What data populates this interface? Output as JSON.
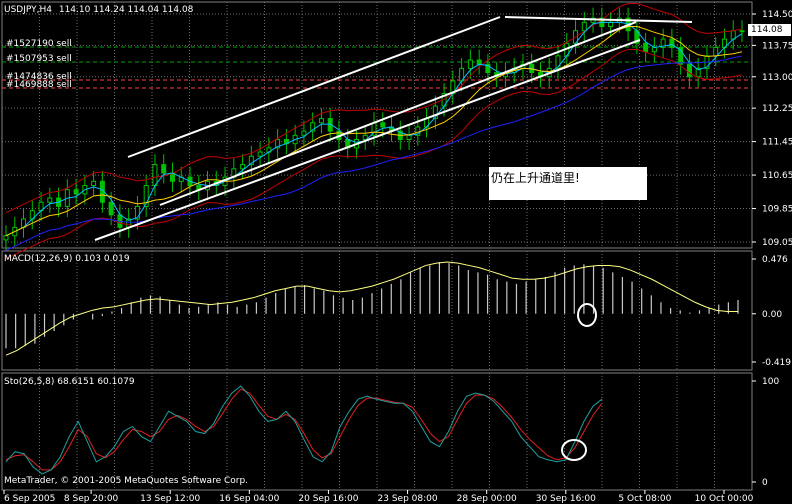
{
  "header": {
    "symbol": "USDJPY,H4",
    "ohlc": "114.10 114.24 114.04 114.08"
  },
  "price_label": "114.08",
  "annotation": "仍在上升通道里!",
  "orders": [
    "#1527190 sell",
    "#1507953 sell",
    "#1474836 sell",
    "#1469888 sell"
  ],
  "price_axis": [
    "114.50",
    "113.75",
    "113.00",
    "112.25",
    "111.45",
    "110.65",
    "109.85",
    "109.05"
  ],
  "macd": {
    "label": "MACD(12,26,9) 0.103 0.019",
    "axis": [
      "0.476",
      "0.00",
      "-0.419"
    ]
  },
  "stoch": {
    "label": "Sto(26,5,8) 68.6151 60.1079",
    "axis": [
      "100",
      "0"
    ]
  },
  "copyright": "MetaTrader, © 2001-2005 MetaQuotes Software Corp.",
  "time_axis": [
    "6 Sep 2005",
    "8 Sep 20:00",
    "13 Sep 12:00",
    "16 Sep 04:00",
    "20 Sep 16:00",
    "23 Sep 08:00",
    "28 Sep 00:00",
    "30 Sep 16:00",
    "5 Oct 08:00",
    "10 Oct 00:00"
  ],
  "colors": {
    "background": "#000000",
    "grid": "#6e6e6e",
    "bull": "#00c000",
    "bear": "#00c000",
    "bands": "#c00000",
    "ma_fast": "#00c0ff",
    "ma_mid": "#ffd000",
    "ma_slow": "#2020ff",
    "macd_line": "#ffff80",
    "stoch_main": "#20a0a0",
    "stoch_signal": "#e02020",
    "orders": "#ff4040",
    "text": "#ffffff"
  },
  "chart_data": {
    "type": "candlestick",
    "symbol": "USDJPY",
    "timeframe": "H4",
    "ylim": [
      109.05,
      114.5
    ],
    "close_series": [
      109.2,
      109.4,
      109.6,
      109.8,
      110.0,
      110.1,
      109.9,
      110.3,
      110.2,
      110.4,
      110.5,
      110.0,
      109.7,
      109.4,
      109.6,
      109.9,
      110.4,
      110.9,
      110.7,
      110.5,
      110.6,
      110.4,
      110.3,
      110.5,
      110.4,
      110.6,
      110.8,
      110.9,
      111.1,
      111.2,
      111.3,
      111.5,
      111.4,
      111.6,
      111.7,
      111.9,
      112.0,
      111.7,
      111.5,
      111.3,
      111.5,
      111.6,
      111.9,
      111.8,
      111.7,
      111.5,
      111.6,
      111.8,
      112.0,
      112.3,
      112.6,
      112.9,
      113.2,
      113.4,
      113.3,
      113.1,
      113.0,
      113.1,
      113.2,
      113.3,
      113.1,
      113.0,
      113.2,
      113.5,
      113.8,
      114.1,
      114.3,
      114.4,
      114.2,
      114.3,
      114.4,
      114.1,
      113.8,
      113.6,
      113.7,
      113.9,
      113.7,
      113.3,
      113.0,
      113.2,
      113.5,
      113.7,
      113.9,
      114.1,
      114.08
    ]
  },
  "macd_data": {
    "ylim": [
      -0.419,
      0.476
    ],
    "histogram": [
      -0.3,
      -0.3,
      -0.28,
      -0.26,
      -0.2,
      -0.15,
      -0.1,
      -0.05,
      0.0,
      -0.05,
      -0.02,
      0.02,
      0.05,
      0.1,
      0.14,
      0.16,
      0.15,
      0.12,
      0.08,
      0.05,
      0.06,
      0.08,
      0.1,
      0.08,
      0.06,
      0.08,
      0.1,
      0.14,
      0.18,
      0.22,
      0.24,
      0.25,
      0.22,
      0.2,
      0.16,
      0.14,
      0.12,
      0.14,
      0.18,
      0.22,
      0.26,
      0.3,
      0.36,
      0.4,
      0.42,
      0.45,
      0.44,
      0.42,
      0.38,
      0.36,
      0.34,
      0.3,
      0.28,
      0.26,
      0.28,
      0.3,
      0.32,
      0.36,
      0.4,
      0.42,
      0.43,
      0.42,
      0.4,
      0.36,
      0.32,
      0.28,
      0.22,
      0.16,
      0.1,
      0.05,
      0.03,
      0.01,
      0.03,
      0.05,
      0.08,
      0.1,
      0.12
    ],
    "signal": [
      -0.36,
      -0.32,
      -0.26,
      -0.2,
      -0.14,
      -0.08,
      -0.03,
      0.0,
      0.03,
      0.05,
      0.06,
      0.08,
      0.1,
      0.12,
      0.13,
      0.12,
      0.11,
      0.1,
      0.09,
      0.08,
      0.09,
      0.1,
      0.12,
      0.14,
      0.17,
      0.2,
      0.22,
      0.24,
      0.24,
      0.22,
      0.2,
      0.19,
      0.2,
      0.22,
      0.24,
      0.27,
      0.3,
      0.34,
      0.38,
      0.42,
      0.44,
      0.45,
      0.44,
      0.42,
      0.4,
      0.37,
      0.34,
      0.31,
      0.3,
      0.3,
      0.31,
      0.33,
      0.36,
      0.39,
      0.41,
      0.42,
      0.42,
      0.41,
      0.38,
      0.34,
      0.3,
      0.25,
      0.2,
      0.15,
      0.1,
      0.06,
      0.03,
      0.02,
      0.02
    ]
  },
  "stoch_data": {
    "ylim": [
      0,
      100
    ],
    "main": [
      20,
      30,
      28,
      15,
      8,
      12,
      25,
      45,
      60,
      40,
      20,
      25,
      35,
      50,
      55,
      45,
      40,
      55,
      70,
      65,
      60,
      50,
      48,
      58,
      75,
      88,
      95,
      85,
      70,
      60,
      62,
      70,
      60,
      42,
      25,
      20,
      30,
      55,
      70,
      82,
      85,
      82,
      80,
      78,
      78,
      70,
      55,
      40,
      35,
      50,
      70,
      85,
      88,
      86,
      80,
      70,
      60,
      45,
      35,
      25,
      22,
      20,
      22,
      40,
      60,
      75,
      82
    ],
    "signal": [
      22,
      26,
      27,
      20,
      12,
      12,
      20,
      35,
      52,
      45,
      28,
      24,
      30,
      42,
      52,
      50,
      45,
      50,
      62,
      66,
      62,
      55,
      50,
      55,
      68,
      82,
      92,
      88,
      76,
      65,
      62,
      67,
      62,
      48,
      32,
      24,
      28,
      45,
      62,
      76,
      83,
      83,
      81,
      79,
      78,
      74,
      62,
      48,
      40,
      45,
      62,
      78,
      86,
      86,
      82,
      74,
      64,
      52,
      42,
      34,
      26,
      22,
      24,
      34,
      50,
      66,
      78
    ]
  }
}
